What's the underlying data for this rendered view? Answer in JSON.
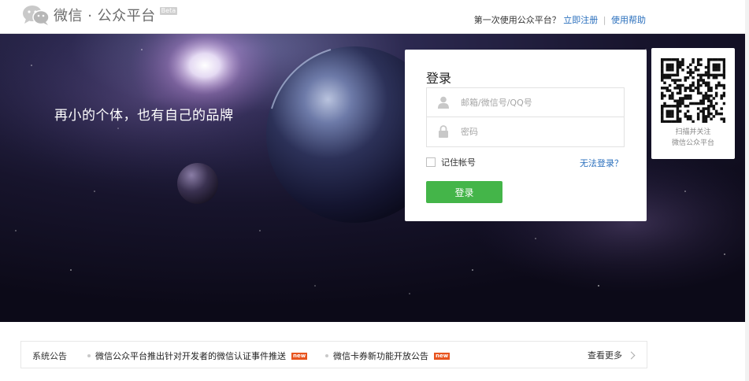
{
  "header": {
    "logo_text": "微信 · 公众平台",
    "beta_badge": "Beta",
    "prompt_text": "第一次使用公众平台？",
    "register_link": "立即注册",
    "separator": "|",
    "help_link": "使用帮助"
  },
  "banner": {
    "slogan": "再小的个体，也有自己的品牌"
  },
  "login": {
    "title": "登录",
    "username_placeholder": "邮箱/微信号/QQ号",
    "password_placeholder": "密码",
    "remember_label": "记住帐号",
    "forgot_link": "无法登录？",
    "submit_label": "登录"
  },
  "qr": {
    "caption_line1": "扫描并关注",
    "caption_line2": "微信公众平台"
  },
  "notice": {
    "label": "系统公告",
    "items": [
      {
        "text": "微信公众平台推出针对开发者的微信认证事件推送",
        "badge": "new"
      },
      {
        "text": "微信卡券新功能开放公告",
        "badge": "new"
      }
    ],
    "more_label": "查看更多"
  },
  "colors": {
    "brand_green": "#44b549",
    "link_blue": "#2a6fbd",
    "new_badge": "#e8541e",
    "banner_dark": "#15122a"
  },
  "icons": [
    "wechat-logo-icon",
    "user-icon",
    "lock-icon",
    "qr-code",
    "chevron-right-icon"
  ]
}
